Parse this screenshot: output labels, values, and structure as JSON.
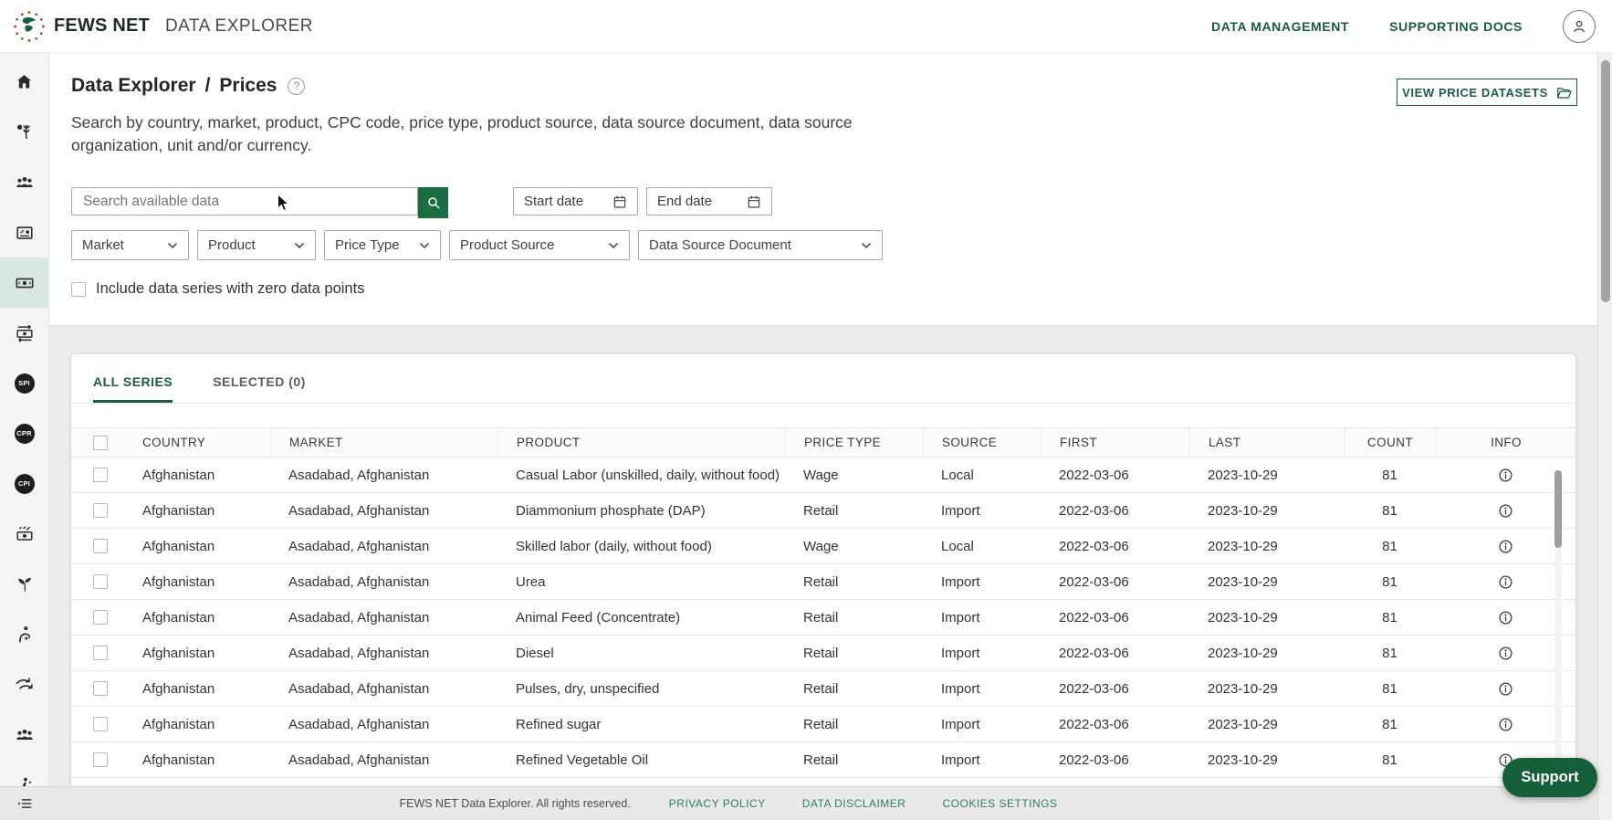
{
  "header": {
    "brand": "FEWS NET",
    "app_title": "DATA EXPLORER",
    "nav": [
      {
        "label": "DATA MANAGEMENT"
      },
      {
        "label": "SUPPORTING DOCS"
      }
    ]
  },
  "sidebar": {
    "items": [
      {
        "name": "home",
        "icon": "home",
        "active": false
      },
      {
        "name": "crop-production",
        "icon": "crop",
        "active": false
      },
      {
        "name": "demographics",
        "icon": "people",
        "active": false
      },
      {
        "name": "market-profiles",
        "icon": "card",
        "active": false
      },
      {
        "name": "prices",
        "icon": "banknote",
        "active": true
      },
      {
        "name": "exchange-rates",
        "icon": "banknote-arrows",
        "active": false
      },
      {
        "name": "spi",
        "icon": "badge",
        "badge": "SPI",
        "active": false
      },
      {
        "name": "cpr",
        "icon": "badge",
        "badge": "CPR",
        "active": false
      },
      {
        "name": "cpi",
        "icon": "badge",
        "badge": "CPI",
        "active": false
      },
      {
        "name": "remittances",
        "icon": "banknote-lines",
        "active": false
      },
      {
        "name": "seed-security",
        "icon": "plant",
        "active": false
      },
      {
        "name": "nutrition",
        "icon": "person-care",
        "active": false
      },
      {
        "name": "trade-flows",
        "icon": "arrows",
        "active": false
      },
      {
        "name": "households",
        "icon": "people",
        "active": false
      },
      {
        "name": "livelihoods",
        "icon": "farmer",
        "active": false
      }
    ]
  },
  "page": {
    "breadcrumb_root": "Data Explorer",
    "breadcrumb_separator": "/",
    "breadcrumb_current": "Prices",
    "help_glyph": "?",
    "view_datasets_button": "VIEW PRICE DATASETS",
    "description": "Search by country, market, product, CPC code, price type, product source, data source document, data source organization, unit and/or currency."
  },
  "filters": {
    "search_placeholder": "Search available data",
    "search_value": "",
    "start_date_placeholder": "Start date",
    "end_date_placeholder": "End date",
    "dropdowns": [
      "Market",
      "Product",
      "Price Type",
      "Product Source",
      "Data Source Document"
    ],
    "zero_checkbox_label": "Include data series with zero data points",
    "zero_checkbox_checked": false
  },
  "tabs": [
    {
      "label": "ALL SERIES",
      "active": true
    },
    {
      "label": "SELECTED (0)",
      "active": false
    }
  ],
  "table": {
    "columns": [
      "COUNTRY",
      "MARKET",
      "PRODUCT",
      "PRICE TYPE",
      "SOURCE",
      "FIRST",
      "LAST",
      "COUNT",
      "INFO"
    ],
    "rows": [
      {
        "country": "Afghanistan",
        "market": "Asadabad, Afghanistan",
        "product": "Casual Labor (unskilled, daily, without food)",
        "price_type": "Wage",
        "source": "Local",
        "first": "2022-03-06",
        "last": "2023-10-29",
        "count": "81"
      },
      {
        "country": "Afghanistan",
        "market": "Asadabad, Afghanistan",
        "product": "Diammonium phosphate (DAP)",
        "price_type": "Retail",
        "source": "Import",
        "first": "2022-03-06",
        "last": "2023-10-29",
        "count": "81"
      },
      {
        "country": "Afghanistan",
        "market": "Asadabad, Afghanistan",
        "product": "Skilled labor (daily, without food)",
        "price_type": "Wage",
        "source": "Local",
        "first": "2022-03-06",
        "last": "2023-10-29",
        "count": "81"
      },
      {
        "country": "Afghanistan",
        "market": "Asadabad, Afghanistan",
        "product": "Urea",
        "price_type": "Retail",
        "source": "Import",
        "first": "2022-03-06",
        "last": "2023-10-29",
        "count": "81"
      },
      {
        "country": "Afghanistan",
        "market": "Asadabad, Afghanistan",
        "product": "Animal Feed (Concentrate)",
        "price_type": "Retail",
        "source": "Import",
        "first": "2022-03-06",
        "last": "2023-10-29",
        "count": "81"
      },
      {
        "country": "Afghanistan",
        "market": "Asadabad, Afghanistan",
        "product": "Diesel",
        "price_type": "Retail",
        "source": "Import",
        "first": "2022-03-06",
        "last": "2023-10-29",
        "count": "81"
      },
      {
        "country": "Afghanistan",
        "market": "Asadabad, Afghanistan",
        "product": "Pulses, dry, unspecified",
        "price_type": "Retail",
        "source": "Import",
        "first": "2022-03-06",
        "last": "2023-10-29",
        "count": "81"
      },
      {
        "country": "Afghanistan",
        "market": "Asadabad, Afghanistan",
        "product": "Refined sugar",
        "price_type": "Retail",
        "source": "Import",
        "first": "2022-03-06",
        "last": "2023-10-29",
        "count": "81"
      },
      {
        "country": "Afghanistan",
        "market": "Asadabad, Afghanistan",
        "product": "Refined Vegetable Oil",
        "price_type": "Retail",
        "source": "Import",
        "first": "2022-03-06",
        "last": "2023-10-29",
        "count": "81"
      }
    ]
  },
  "footer": {
    "copyright": "FEWS NET Data Explorer. All rights reserved.",
    "links": [
      "PRIVACY POLICY",
      "DATA DISCLAIMER",
      "COOKIES SETTINGS"
    ]
  },
  "support": {
    "label": "Support"
  },
  "colors": {
    "accent_green": "#1d5c44",
    "search_button_green": "#1a6d3e",
    "support_green": "#15603a",
    "active_sidebar_bg": "#d9e7e0",
    "footer_link_green": "#2e7d5f"
  }
}
